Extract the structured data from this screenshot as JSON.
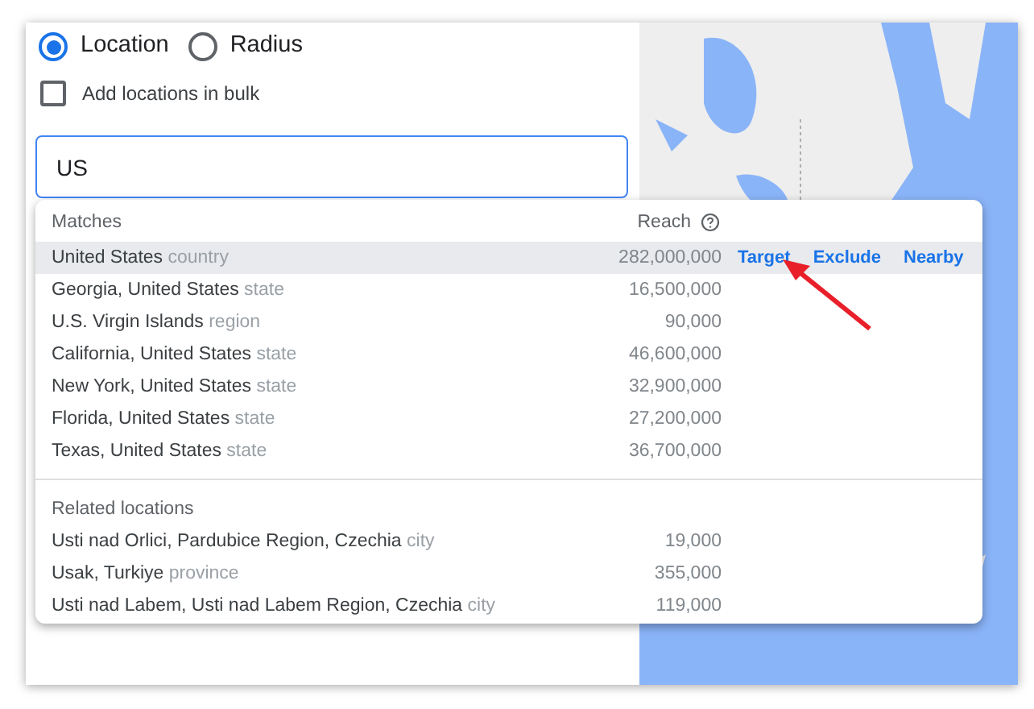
{
  "mode_options": [
    {
      "label": "Location",
      "selected": true
    },
    {
      "label": "Radius",
      "selected": false
    }
  ],
  "bulk": {
    "label": "Add locations in bulk",
    "checked": false
  },
  "search": {
    "value": "US"
  },
  "matches": {
    "heading": "Matches",
    "reach_heading": "Reach",
    "rows": [
      {
        "name": "United States",
        "type": "country",
        "reach": "282,000,000",
        "selected": true,
        "actions": [
          "Target",
          "Exclude",
          "Nearby"
        ]
      },
      {
        "name": "Georgia, United States",
        "type": "state",
        "reach": "16,500,000",
        "selected": false
      },
      {
        "name": "U.S. Virgin Islands",
        "type": "region",
        "reach": "90,000",
        "selected": false
      },
      {
        "name": "California, United States",
        "type": "state",
        "reach": "46,600,000",
        "selected": false
      },
      {
        "name": "New York, United States",
        "type": "state",
        "reach": "32,900,000",
        "selected": false
      },
      {
        "name": "Florida, United States",
        "type": "state",
        "reach": "27,200,000",
        "selected": false
      },
      {
        "name": "Texas, United States",
        "type": "state",
        "reach": "36,700,000",
        "selected": false
      }
    ]
  },
  "related": {
    "heading": "Related locations",
    "rows": [
      {
        "name": "Usti nad Orlici, Pardubice Region, Czechia",
        "type": "city",
        "reach": "19,000",
        "selected": false
      },
      {
        "name": "Usak, Turkiye",
        "type": "province",
        "reach": "355,000",
        "selected": false
      },
      {
        "name": "Usti nad Labem, Usti nad Labem Region, Czechia",
        "type": "city",
        "reach": "119,000",
        "selected": false
      }
    ]
  }
}
